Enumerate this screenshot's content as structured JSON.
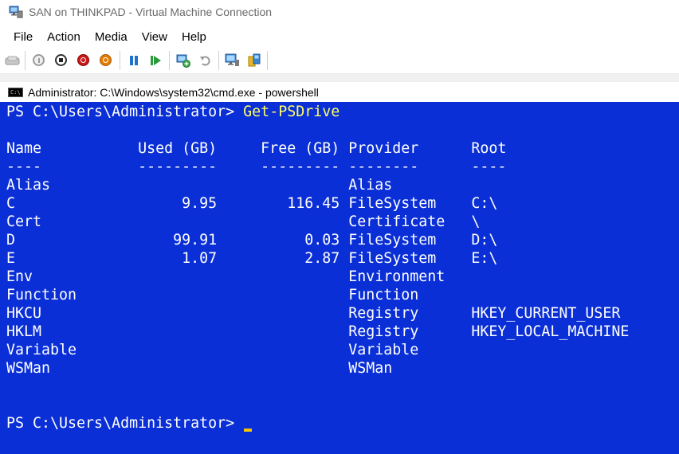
{
  "window": {
    "title": "SAN on THINKPAD - Virtual Machine Connection"
  },
  "menu": {
    "items": [
      "File",
      "Action",
      "Media",
      "View",
      "Help"
    ]
  },
  "toolbar": {
    "icons": [
      "ctrl-alt-del-icon",
      "start-icon",
      "turn-off-icon",
      "shut-down-icon",
      "power-icon",
      "pause-icon",
      "resume-icon",
      "checkpoint-icon",
      "revert-icon",
      "enhanced-session-icon",
      "share-icon"
    ]
  },
  "console_window": {
    "title": "Administrator: C:\\Windows\\system32\\cmd.exe - powershell"
  },
  "console": {
    "prompt": "PS C:\\Users\\Administrator> ",
    "command": "Get-PSDrive",
    "header": "Name           Used (GB)     Free (GB) Provider      Root",
    "underline": "----           ---------     --------- --------      ----",
    "rows": [
      "Alias                                  Alias",
      "C                   9.95        116.45 FileSystem    C:\\",
      "Cert                                   Certificate   \\",
      "D                  99.91          0.03 FileSystem    D:\\",
      "E                   1.07          2.87 FileSystem    E:\\",
      "Env                                    Environment",
      "Function                               Function",
      "HKCU                                   Registry      HKEY_CURRENT_USER",
      "HKLM                                   Registry      HKEY_LOCAL_MACHINE",
      "Variable                               Variable",
      "WSMan                                  WSMan"
    ],
    "final_prompt": "PS C:\\Users\\Administrator> "
  }
}
